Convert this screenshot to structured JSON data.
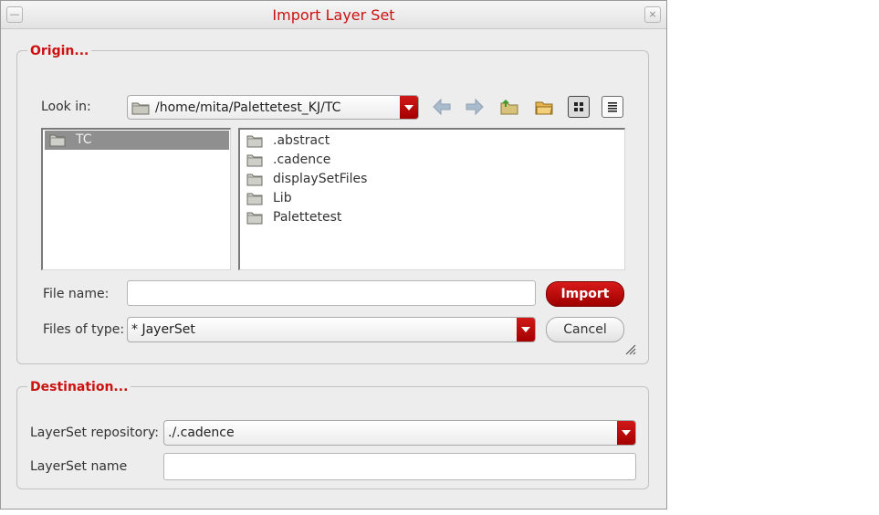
{
  "window": {
    "title": "Import Layer Set"
  },
  "origin": {
    "legend": "Origin...",
    "look_in_label": "Look in:",
    "look_in_path": "/home/mita/Palettetest_KJ/TC",
    "sidebar_items": [
      {
        "label": "TC",
        "selected": true
      }
    ],
    "files": [
      {
        "label": ".abstract"
      },
      {
        "label": ".cadence"
      },
      {
        "label": "displaySetFiles"
      },
      {
        "label": "Lib"
      },
      {
        "label": "Palettetest"
      }
    ],
    "file_name_label": "File name:",
    "file_name_value": "",
    "files_of_type_label": "Files of type:",
    "files_of_type_value": "* JayerSet",
    "import_button": "Import",
    "cancel_button": "Cancel",
    "view_mode": "icon-grid"
  },
  "destination": {
    "legend": "Destination...",
    "repository_label": "LayerSet repository:",
    "repository_value": "./.cadence",
    "name_label": "LayerSet name",
    "name_value": ""
  },
  "colors": {
    "accent": "#cc1111",
    "dialog_bg": "#ededed",
    "selection": "#8f8f8f"
  }
}
